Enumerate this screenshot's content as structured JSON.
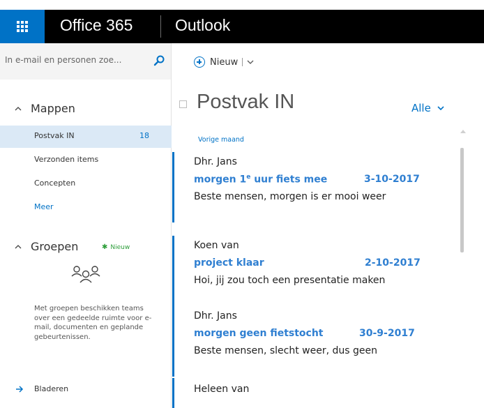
{
  "app": {
    "suite_name": "Office 365",
    "app_name": "Outlook",
    "waffle_color": "#0072c6",
    "bar_color": "#000000"
  },
  "search": {
    "placeholder": "In e-mail en personen zoe..."
  },
  "toolbar": {
    "new_label": "Nieuw"
  },
  "nav": {
    "folders_header": "Mappen",
    "folders": [
      {
        "label": "Postvak IN",
        "count": "18",
        "selected": true
      },
      {
        "label": "Verzonden items",
        "count": ""
      },
      {
        "label": "Concepten",
        "count": ""
      },
      {
        "label": "Meer",
        "count": "",
        "link": true
      }
    ],
    "groups_header": "Groepen",
    "new_group_label": "Nieuw",
    "groups_description": "Met groepen beschikken teams over een gedeelde ruimte voor e-mail, documenten en geplande gebeurtenissen.",
    "browse_label": "Bladeren"
  },
  "list": {
    "title": "Postvak IN",
    "filter_label": "Alle",
    "group_header": "Vorige maand",
    "messages": [
      {
        "sender": "Dhr. Jans",
        "subject": "morgen 1",
        "subject_sup": "e",
        "subject_rest": " uur fiets mee",
        "date": "3-10-2017",
        "preview": "Beste mensen, morgen is er mooi weer"
      },
      {
        "sender": "Koen van",
        "subject": "project klaar",
        "subject_sup": "",
        "subject_rest": "",
        "date": "2-10-2017",
        "preview": "Hoi, jij zou toch een presentatie maken"
      },
      {
        "sender": "Dhr. Jans",
        "subject": "morgen geen fietstocht",
        "subject_sup": "",
        "subject_rest": "",
        "date": "30-9-2017",
        "preview": "Beste mensen, slecht weer, dus geen"
      },
      {
        "sender": "Heleen van",
        "subject": "",
        "subject_sup": "",
        "subject_rest": "",
        "date": "",
        "preview": ""
      }
    ]
  }
}
